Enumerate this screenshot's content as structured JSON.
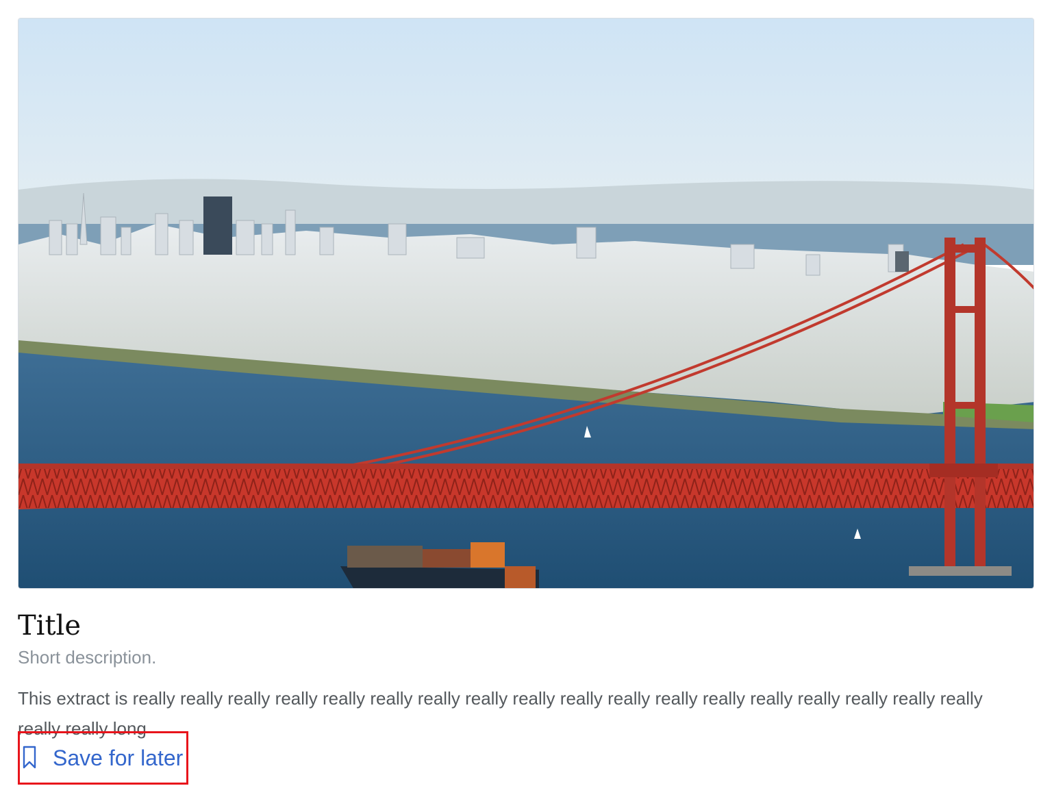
{
  "card": {
    "image": {
      "icon": "san-francisco-golden-gate-photo"
    },
    "title": "Title",
    "description": "Short description.",
    "extract": "This extract is really really really really really really really really really really really really really really really really really really really really long"
  },
  "save": {
    "label": "Save for later",
    "icon": "bookmark-icon",
    "accent_color": "#3366cc",
    "highlight_color": "#e8141b"
  }
}
